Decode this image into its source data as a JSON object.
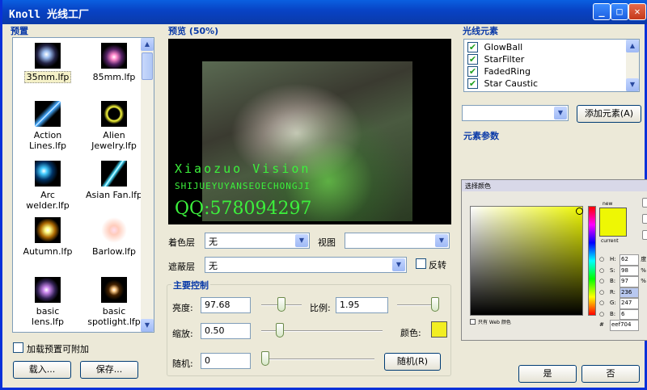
{
  "window": {
    "title": "Knoll 光线工厂",
    "min_glyph": "_",
    "max_glyph": "□",
    "close_glyph": "✕"
  },
  "presets": {
    "header": "预置",
    "items": [
      {
        "label": "35mm.lfp"
      },
      {
        "label": "85mm.lfp"
      },
      {
        "label": "Action Lines.lfp"
      },
      {
        "label": "Alien Jewelry.lfp"
      },
      {
        "label": "Arc welder.lfp"
      },
      {
        "label": "Asian Fan.lfp"
      },
      {
        "label": "Autumn.lfp"
      },
      {
        "label": "Barlow.lfp"
      },
      {
        "label": "basic lens.lfp"
      },
      {
        "label": "basic spotlight.lfp"
      }
    ],
    "append_label": "加载预置可附加",
    "load_button": "载入...",
    "save_button": "保存..."
  },
  "preview": {
    "header": "预览 (50%)",
    "watermark_line1": "Xiaozuo Vision",
    "watermark_line2": "SHIJUEYUYANSEOECHONGJI",
    "watermark_line3": "QQ:578094297"
  },
  "controls": {
    "color_layer_label": "着色层",
    "color_layer_value": "无",
    "view_label": "视图",
    "view_value": "",
    "mask_layer_label": "遮蔽层",
    "mask_layer_value": "无",
    "invert_label": "反转",
    "main_header": "主要控制",
    "brightness_label": "亮度:",
    "brightness_value": "97.68",
    "scale_label": "比例:",
    "scale_value": "1.95",
    "zoom_label": "缩放:",
    "zoom_value": "0.50",
    "color_label": "颜色:",
    "random_label": "随机:",
    "random_value": "0",
    "random_button": "随机(R)",
    "swatch_color": "#f2ee22"
  },
  "elements": {
    "header": "光线元素",
    "items": [
      {
        "label": "GlowBall",
        "checked": "✔"
      },
      {
        "label": "StarFilter",
        "checked": "✔"
      },
      {
        "label": "FadedRing",
        "checked": "✔"
      },
      {
        "label": "Star Caustic",
        "checked": "✔"
      }
    ],
    "add_button": "添加元素(A)",
    "params_header": "元素参数"
  },
  "color_picker": {
    "title": "选择颜色",
    "new_label": "new",
    "current_label": "current",
    "web_only_label": "只有 Web 颜色",
    "h_label": "H:",
    "h_value": "62",
    "h_unit": "度",
    "s_label": "S:",
    "s_value": "98",
    "s_unit": "%",
    "b_label": "B:",
    "b_value": "97",
    "b_unit": "%",
    "r_label": "R:",
    "r_value": "236",
    "g_label": "G:",
    "g_value": "247",
    "bl_label": "B:",
    "bl_value": "6",
    "hex_label": "#",
    "hex_value": "eef704",
    "new_color": "#eef704",
    "current_color": "#eef704"
  },
  "dialog": {
    "ok_button": "是",
    "cancel_button": "否"
  }
}
